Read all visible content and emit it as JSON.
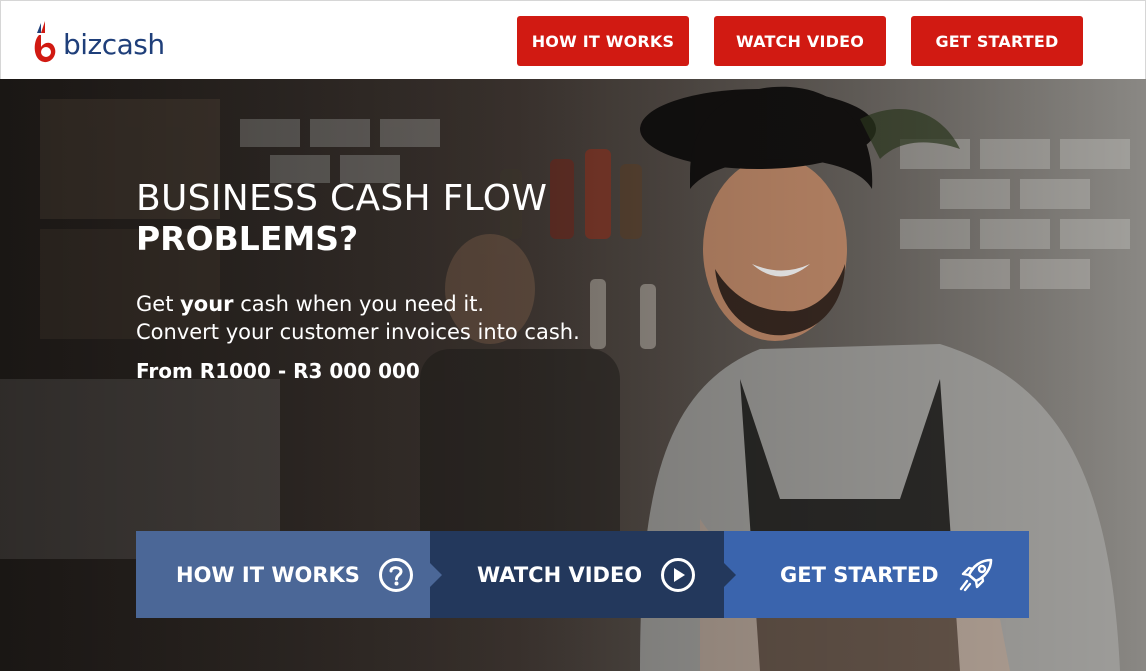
{
  "header": {
    "logo_text": "bizcash",
    "nav": [
      {
        "label": "HOW IT WORKS"
      },
      {
        "label": "WATCH VIDEO"
      },
      {
        "label": "GET STARTED"
      }
    ]
  },
  "hero": {
    "headline_line1": "BUSINESS CASH FLOW",
    "headline_line2": "PROBLEMS?",
    "sub_pre": "Get ",
    "sub_bold": "your",
    "sub_post": " cash when you need it.",
    "sub_line2": "Convert your customer invoices into cash.",
    "range": "From R1000 - R3 000 000"
  },
  "actions": [
    {
      "label": "HOW IT WORKS",
      "icon": "question-circle-icon"
    },
    {
      "label": "WATCH VIDEO",
      "icon": "play-circle-icon"
    },
    {
      "label": "GET STARTED",
      "icon": "rocket-icon"
    }
  ],
  "colors": {
    "brand_red": "#d11a12",
    "brand_blue": "#1f3f7a",
    "action1": "#4b6797",
    "action2": "#23385c",
    "action3": "#3a64ad"
  }
}
